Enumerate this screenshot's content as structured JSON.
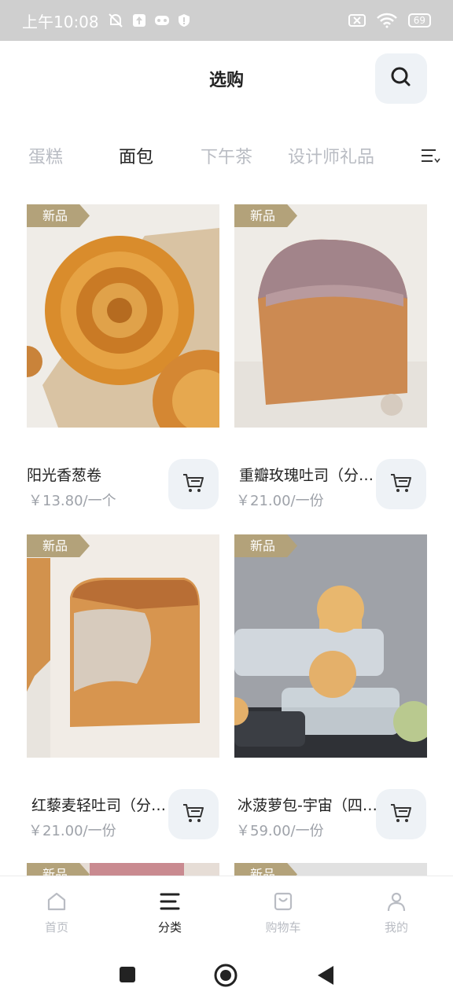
{
  "status": {
    "time": "上午10:08",
    "battery": "69"
  },
  "header": {
    "title": "选购"
  },
  "tabs": [
    {
      "label": "蛋糕",
      "active": false
    },
    {
      "label": "面包",
      "active": true
    },
    {
      "label": "下午茶",
      "active": false
    },
    {
      "label": "设计师礼品",
      "active": false
    }
  ],
  "products": [
    {
      "badge": "新品",
      "name": "阳光香葱卷",
      "price": "￥13.80/一个"
    },
    {
      "badge": "新品",
      "name": "重瓣玫瑰吐司（分…",
      "price": "￥21.00/一份"
    },
    {
      "badge": "新品",
      "name": "红藜麦轻吐司（分…",
      "price": "￥21.00/一份"
    },
    {
      "badge": "新品",
      "name": "冰菠萝包-宇宙（四…",
      "price": "￥59.00/一份"
    },
    {
      "badge": "新品"
    },
    {
      "badge": "新品"
    }
  ],
  "tabbar": [
    {
      "label": "首页",
      "icon": "home-icon"
    },
    {
      "label": "分类",
      "icon": "list-icon"
    },
    {
      "label": "购物车",
      "icon": "shopping-bag-icon"
    },
    {
      "label": "我的",
      "icon": "user-icon"
    }
  ]
}
